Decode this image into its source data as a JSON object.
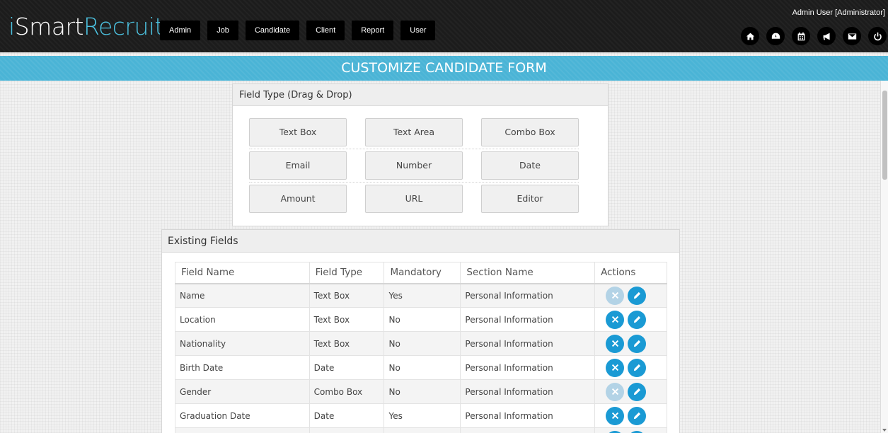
{
  "app": {
    "logo_prefix": "i",
    "logo_mid": "Smart",
    "logo_suffix": "Recruit"
  },
  "nav": [
    "Admin",
    "Job",
    "Candidate",
    "Client",
    "Report",
    "User"
  ],
  "user": {
    "label": "Admin User [Administrator]"
  },
  "header_icons": [
    "home-icon",
    "dashboard-icon",
    "calendar-icon",
    "megaphone-icon",
    "envelope-icon",
    "power-icon"
  ],
  "page": {
    "title": "CUSTOMIZE CANDIDATE FORM"
  },
  "field_types": {
    "title": "Field Type (Drag & Drop)",
    "items": [
      "Text Box",
      "Text Area",
      "Combo Box",
      "Email",
      "Number",
      "Date",
      "Amount",
      "URL",
      "Editor"
    ]
  },
  "existing_fields": {
    "title": "Existing Fields",
    "columns": [
      "Field Name",
      "Field Type",
      "Mandatory",
      "Section Name",
      "Actions"
    ],
    "rows": [
      {
        "name": "Name",
        "type": "Text Box",
        "mandatory": "Yes",
        "section": "Personal Information",
        "delete_enabled": false
      },
      {
        "name": "Location",
        "type": "Text Box",
        "mandatory": "No",
        "section": "Personal Information",
        "delete_enabled": true
      },
      {
        "name": "Nationality",
        "type": "Text Box",
        "mandatory": "No",
        "section": "Personal Information",
        "delete_enabled": true
      },
      {
        "name": "Birth Date",
        "type": "Date",
        "mandatory": "No",
        "section": "Personal Information",
        "delete_enabled": true
      },
      {
        "name": "Gender",
        "type": "Combo Box",
        "mandatory": "No",
        "section": "Personal Information",
        "delete_enabled": false
      },
      {
        "name": "Graduation Date",
        "type": "Date",
        "mandatory": "Yes",
        "section": "Personal Information",
        "delete_enabled": true
      },
      {
        "name": "",
        "type": "",
        "mandatory": "",
        "section": "",
        "delete_enabled": true
      }
    ]
  },
  "colors": {
    "accent": "#4ab4d6",
    "action": "#1a9ad4",
    "action_disabled": "#b3d3e6",
    "header_bg": "#1c1c1c"
  }
}
